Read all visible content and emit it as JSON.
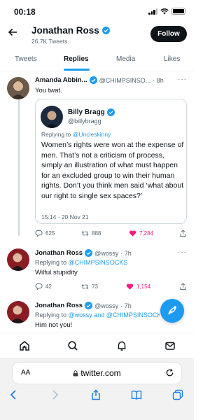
{
  "status_bar": {
    "time": "00:18"
  },
  "header": {
    "name": "Jonathan Ross",
    "subtitle": "26.7K Tweets",
    "follow_label": "Follow"
  },
  "tabs": [
    "Tweets",
    "Replies",
    "Media",
    "Likes"
  ],
  "active_tab": "Replies",
  "tweets": [
    {
      "name": "Amanda Abbin...",
      "handle": "@CHIMPSINSO...",
      "time": "· 8h",
      "text": "You twat."
    },
    {
      "name": "Jonathan Ross",
      "handle": "@wossy",
      "time": "· 7h",
      "reply_prefix": "Replying to",
      "reply_to": "@CHIMPSINSOCKS",
      "text": "Wilful stupidity",
      "replies": "42",
      "retweets": "73",
      "likes": "1,154"
    },
    {
      "name": "Jonathan Ross",
      "handle": "@wossy",
      "time": "· 7h",
      "reply_prefix": "Replying to",
      "reply_to": "@wossy and @CHIMPSINSOCKS",
      "text": "Him not you!"
    }
  ],
  "quote": {
    "name": "Billy Bragg",
    "handle": "@billybragg",
    "reply_prefix": "Replying to",
    "reply_to": "@Uncleskinny",
    "text": "Women’s rights were won at the expense of men. That’s not a criticism of process, simply an illustration of what must happen for an excluded group to win their human rights. Don’t you think men said ‘what about our right to single sex spaces?’",
    "timestamp": "15:14 · 20 Nov 21"
  },
  "tweet1_stats": {
    "replies": "625",
    "retweets": "888",
    "likes": "7,284"
  },
  "browser": {
    "aa_label": "AA",
    "url": "twitter.com"
  },
  "colors": {
    "accent": "#1d9bf0",
    "like": "#f91880",
    "text": "#0f1419",
    "muted": "#536471"
  },
  "icons": {
    "nav": [
      "home-icon",
      "search-icon",
      "notifications-bell-icon",
      "messages-envelope-icon"
    ],
    "safari": [
      "back-icon",
      "forward-icon",
      "share-icon",
      "bookmarks-icon",
      "tabs-icon"
    ]
  }
}
